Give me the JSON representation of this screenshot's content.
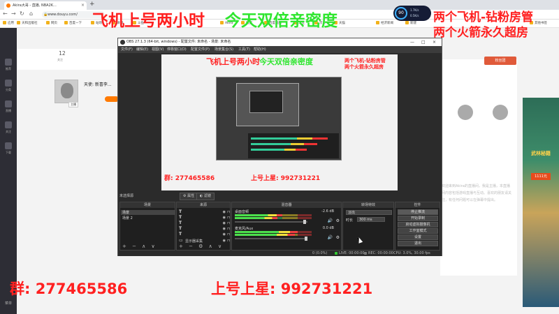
{
  "browser": {
    "tab_title": "Akira大哥 - 直播, NBA2K...",
    "tab_close": "×",
    "new_tab": "+",
    "url": "www.douyu.com/",
    "bookmarks": [
      "应用",
      "天和出版社",
      "网页",
      "百度一下",
      "站场",
      "微博",
      "斗鱼",
      "Akira",
      "搜狐",
      "百度视频",
      "淘宝",
      "京东",
      "天猫",
      "经济新闻",
      "新建",
      "其他书签"
    ]
  },
  "page": {
    "viewer_count": "12",
    "viewer_label": "关注",
    "streamer_name": "天使: 新喜李...",
    "avatar_tag": "主播",
    "follow_button": "粉丝团",
    "left_nav": [
      "推荐",
      "分类",
      "直播",
      "关注",
      "下载"
    ],
    "left_nav_bottom": "菜单",
    "right_desc": "欢迎来到Akira的直播间，我是主播，本直播间内容包括游戏直播与互动。喜欢的朋友请关注，有任何问题可以在弹幕中提出。",
    "ad_title": "武林秘籍",
    "ad_price": "1111元"
  },
  "obs": {
    "title": "OBS 27.1.3 (64-bit, windows) - 配置文件: 未命名 - 场景: 未命名",
    "menu": [
      "文件(F)",
      "编辑(E)",
      "视图(V)",
      "停靠窗口(D)",
      "配置文件(P)",
      "场景集合(S)",
      "工具(T)",
      "帮助(H)"
    ],
    "no_source": "未选择源",
    "props_button": "属性",
    "filters_button": "滤镜",
    "docks": {
      "scenes": "场景",
      "sources": "来源",
      "mixer": "混音器",
      "transitions": "转场特效",
      "controls": "控件"
    },
    "scenes": [
      "场景",
      "场景 2"
    ],
    "sources": [
      "",
      "",
      "",
      "",
      "",
      "显示器采集"
    ],
    "mixer": [
      {
        "name": "桌面音频",
        "db": "-2.6 dB",
        "level": 0.62
      },
      {
        "name": "麦克风/Aux",
        "db": "0.0 dB",
        "level": 0.82
      }
    ],
    "transition": {
      "label": "淡出",
      "duration_label": "时长",
      "duration_value": "300 ms"
    },
    "controls": [
      "停止推流",
      "开始录制",
      "启动虚拟摄像机",
      "工作室模式",
      "设置",
      "退出"
    ],
    "status": {
      "dropped": "0 (0.0%)",
      "live": "LIVE: 00:00:00",
      "rec": "REC: 00:00:00",
      "cpu": "CPU: 3.0%, 30.00 fps"
    },
    "preview_overlay": {
      "top_red": "飞机上号两小时",
      "top_green": "今天双倍亲密度",
      "right_1": "两个飞机-钻粉房管",
      "right_2": "两个火箭永久超房",
      "bottom_1": "群: 277465586",
      "bottom_2": "上号上星: 992731221"
    }
  },
  "overlay": {
    "top_red": "飞机上号两小时",
    "top_green": "今天双倍亲密度",
    "right_1": "两个飞机-钻粉房管",
    "right_2": "两个火箭永久超房",
    "bottom_1": "群: 277465586",
    "bottom_2": "上号上星: 992731221"
  },
  "net_widget": {
    "percent": "90",
    "up": "1.7K/s",
    "down": "0.5K/s"
  },
  "colors": {
    "overlay_red": "#ff2020",
    "overlay_green": "#2ee62e",
    "obs_bg": "#2b2b2b",
    "douyu_orange": "#ff7a00"
  }
}
